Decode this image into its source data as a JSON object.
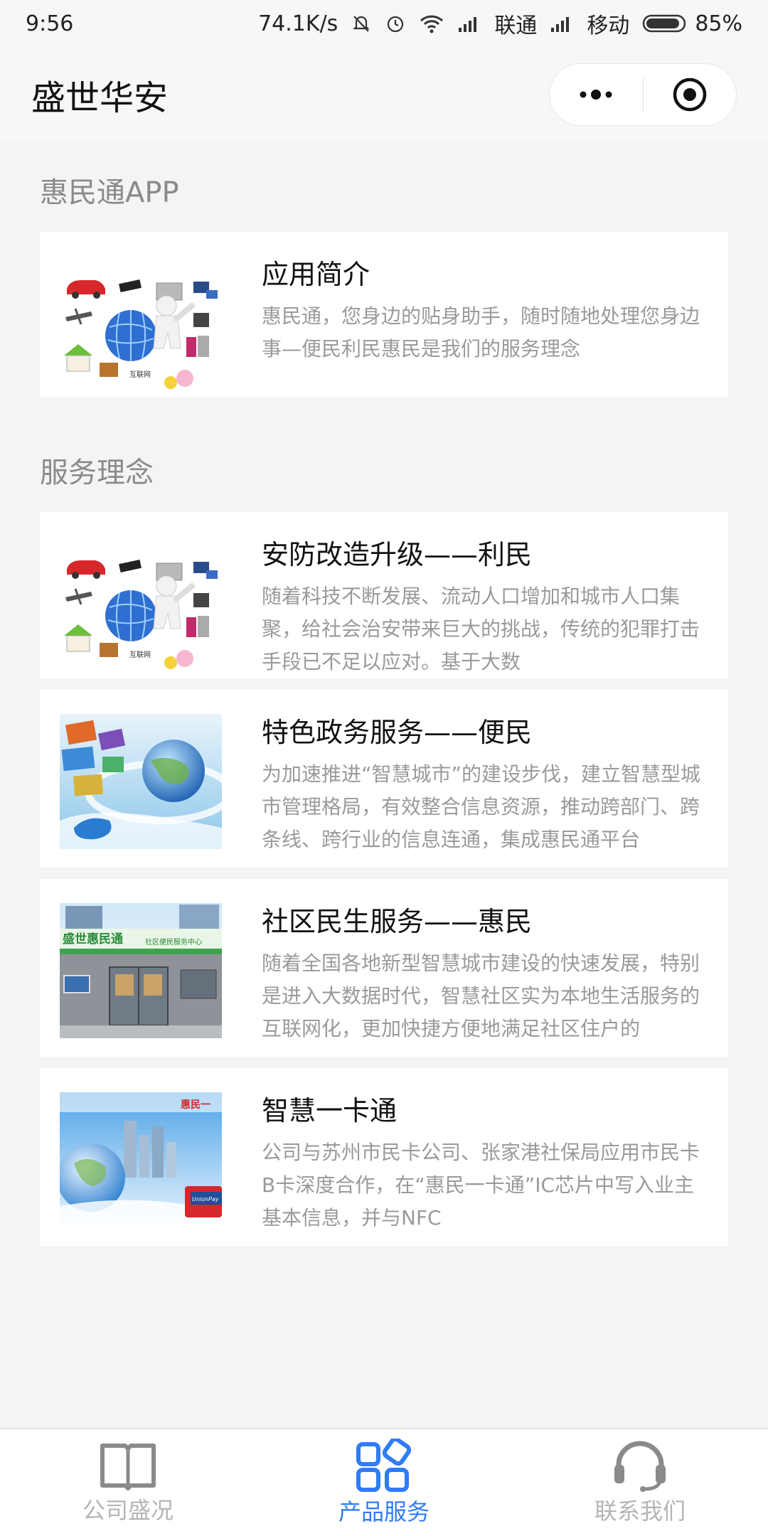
{
  "status": {
    "time": "9:56",
    "network_speed": "74.1K/s",
    "carrier_1": "联通",
    "carrier_2": "移动",
    "battery": "85%"
  },
  "navbar": {
    "title": "盛世华安",
    "menu_icon": "more-dots-icon",
    "close_icon": "target-circle-icon"
  },
  "sections": [
    {
      "title": "惠民通APP",
      "items": [
        {
          "title": "应用简介",
          "desc": "惠民通，您身边的贴身助手，随时随地处理您身边事—便民利民惠民是我们的服务理念",
          "image": "internet-collage"
        }
      ]
    },
    {
      "title": "服务理念",
      "items": [
        {
          "title": "安防改造升级——利民",
          "desc": "随着科技不断发展、流动人口增加和城市人口集聚，给社会治安带来巨大的挑战，传统的犯罪打击手段已不足以应对。基于大数",
          "image": "internet-collage"
        },
        {
          "title": "特色政务服务——便民",
          "desc": "为加速推进“智慧城市”的建设步伐，建立智慧型城市管理格局，有效整合信息资源，推动跨部门、跨条线、跨行业的信息连通，集成惠民通平台",
          "image": "globe-tech"
        },
        {
          "title": "社区民生服务——惠民",
          "desc": "随着全国各地新型智慧城市建设的快速发展，特别是进入大数据时代，智慧社区实为本地生活服务的互联网化，更加快捷方便地满足社区住户的",
          "image": "storefront",
          "store_sign": "盛世惠民通",
          "store_sub": "社区便民服务中心"
        },
        {
          "title": "智慧一卡通",
          "desc": "公司与苏州市民卡公司、张家港社保局应用市民卡B卡深度合作，在“惠民一卡通”IC芯片中写入业主基本信息，并与NFC",
          "image": "city-card",
          "card_text": "惠民一",
          "unionpay_text": "UnionPay"
        }
      ]
    }
  ],
  "tabbar": [
    {
      "label": "公司盛况",
      "icon": "book-icon",
      "active": false
    },
    {
      "label": "产品服务",
      "icon": "apps-grid-icon",
      "active": true
    },
    {
      "label": "联系我们",
      "icon": "headset-icon",
      "active": false
    }
  ],
  "colors": {
    "accent": "#2f7cf6",
    "inactive": "#b5b5b5",
    "desc": "#9a9a9a",
    "section_title": "#8a8a8a"
  }
}
